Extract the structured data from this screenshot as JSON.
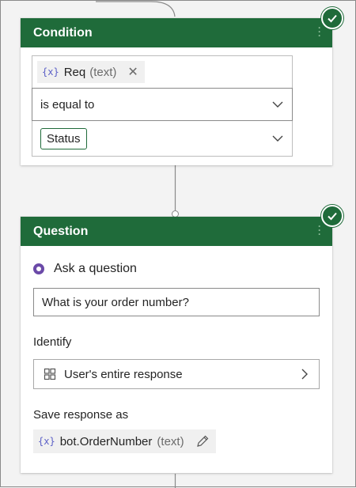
{
  "condition": {
    "title": "Condition",
    "variable": {
      "icon": "variable-icon",
      "brace_text": "{x}",
      "name": "Req",
      "type": "(text)",
      "remove": "✕"
    },
    "operator": "is equal to",
    "value_tag": "Status"
  },
  "question": {
    "title": "Question",
    "ask_label": "Ask a question",
    "question_text": "What is your order number?",
    "identify_label": "Identify",
    "identify_value": "User's entire response",
    "save_label": "Save response as",
    "save_variable": {
      "brace_text": "{x}",
      "name": "bot.OrderNumber",
      "type": "(text)"
    }
  },
  "colors": {
    "header_green": "#1f6b3a",
    "radio_purple": "#6b4aa8",
    "variable_icon_blue": "#5b5fc7"
  },
  "icons": [
    "check-circle-icon",
    "kebab-menu-icon",
    "variable-icon",
    "close-icon",
    "chevron-down-icon",
    "radio-selected-icon",
    "grid-icon",
    "chevron-right-icon",
    "pencil-icon"
  ]
}
